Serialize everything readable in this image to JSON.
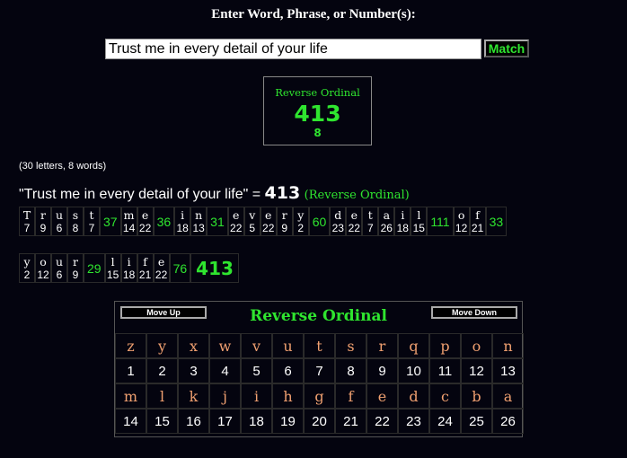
{
  "title": "Enter Word, Phrase, or Number(s):",
  "search": {
    "value": "Trust me in every detail of your life"
  },
  "match_label": "Match",
  "result": {
    "cipher": "Reverse Ordinal",
    "value": "413",
    "reduction": "8"
  },
  "stats": "(30 letters, 8 words)",
  "phrase": {
    "text": "\"Trust me in every detail of your life\" =",
    "value": "413",
    "cipher": "(Reverse Ordinal)"
  },
  "breakdown_row1": [
    {
      "letters": [
        [
          "T",
          "7"
        ],
        [
          "r",
          "9"
        ],
        [
          "u",
          "6"
        ],
        [
          "s",
          "8"
        ],
        [
          "t",
          "7"
        ]
      ],
      "sum": "37"
    },
    {
      "letters": [
        [
          "m",
          "14"
        ],
        [
          "e",
          "22"
        ]
      ],
      "sum": "36"
    },
    {
      "letters": [
        [
          "i",
          "18"
        ],
        [
          "n",
          "13"
        ]
      ],
      "sum": "31"
    },
    {
      "letters": [
        [
          "e",
          "22"
        ],
        [
          "v",
          "5"
        ],
        [
          "e",
          "22"
        ],
        [
          "r",
          "9"
        ],
        [
          "y",
          "2"
        ]
      ],
      "sum": "60"
    },
    {
      "letters": [
        [
          "d",
          "23"
        ],
        [
          "e",
          "22"
        ],
        [
          "t",
          "7"
        ],
        [
          "a",
          "26"
        ],
        [
          "i",
          "18"
        ],
        [
          "l",
          "15"
        ]
      ],
      "sum": "111"
    },
    {
      "letters": [
        [
          "o",
          "12"
        ],
        [
          "f",
          "21"
        ]
      ],
      "sum": "33"
    }
  ],
  "breakdown_row2": [
    {
      "letters": [
        [
          "y",
          "2"
        ],
        [
          "o",
          "12"
        ],
        [
          "u",
          "6"
        ],
        [
          "r",
          "9"
        ]
      ],
      "sum": "29"
    },
    {
      "letters": [
        [
          "l",
          "15"
        ],
        [
          "i",
          "18"
        ],
        [
          "f",
          "21"
        ],
        [
          "e",
          "22"
        ]
      ],
      "sum": "76"
    }
  ],
  "breakdown_total": "413",
  "cipher_table": {
    "move_up": "Move Up",
    "move_down": "Move Down",
    "title": "Reverse Ordinal",
    "row1_letters": [
      "z",
      "y",
      "x",
      "w",
      "v",
      "u",
      "t",
      "s",
      "r",
      "q",
      "p",
      "o",
      "n"
    ],
    "row1_numbers": [
      "1",
      "2",
      "3",
      "4",
      "5",
      "6",
      "7",
      "8",
      "9",
      "10",
      "11",
      "12",
      "13"
    ],
    "row2_letters": [
      "m",
      "l",
      "k",
      "j",
      "i",
      "h",
      "g",
      "f",
      "e",
      "d",
      "c",
      "b",
      "a"
    ],
    "row2_numbers": [
      "14",
      "15",
      "16",
      "17",
      "18",
      "19",
      "20",
      "21",
      "22",
      "23",
      "24",
      "25",
      "26"
    ]
  }
}
